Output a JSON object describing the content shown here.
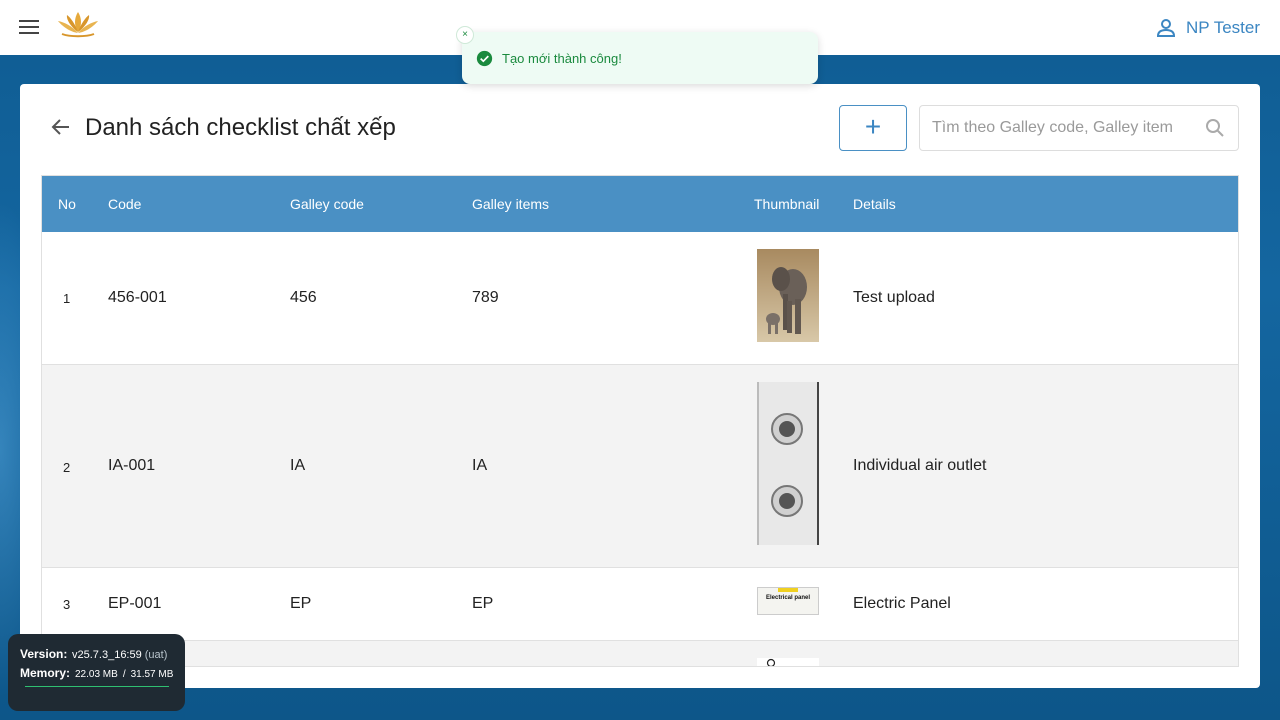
{
  "header": {
    "user_name": "NP Tester"
  },
  "toast": {
    "message": "Tạo mới thành công!",
    "close_glyph": "×"
  },
  "page": {
    "title": "Danh sách checklist chất xếp",
    "add_glyph": "+",
    "search_placeholder": "Tìm theo Galley code, Galley item"
  },
  "table": {
    "columns": [
      "No",
      "Code",
      "Galley code",
      "Galley items",
      "Thumbnail",
      "Details"
    ],
    "rows": [
      {
        "no": "1",
        "code": "456-001",
        "galley_code": "456",
        "galley_items": "789",
        "details": "Test upload",
        "thumbnail": "elephant-image"
      },
      {
        "no": "2",
        "code": "IA-001",
        "galley_code": "IA",
        "galley_items": "IA",
        "details": "Individual air outlet",
        "thumbnail": "air-outlet-image"
      },
      {
        "no": "3",
        "code": "EP-001",
        "galley_code": "EP",
        "galley_items": "EP",
        "details": "Electric Panel",
        "thumbnail": "electric-panel-image",
        "thumbnail_text": "Electrical panel"
      }
    ]
  },
  "version_panel": {
    "version_label": "Version:",
    "version_value": "v25.7.3_16:59",
    "version_env": "(uat)",
    "memory_label": "Memory:",
    "memory_used": "22.03 MB",
    "memory_separator": "/",
    "memory_total": "31.57 MB"
  },
  "colors": {
    "primary": "#4a90c4",
    "success": "#1a8a3e",
    "background": "#1466a0"
  }
}
